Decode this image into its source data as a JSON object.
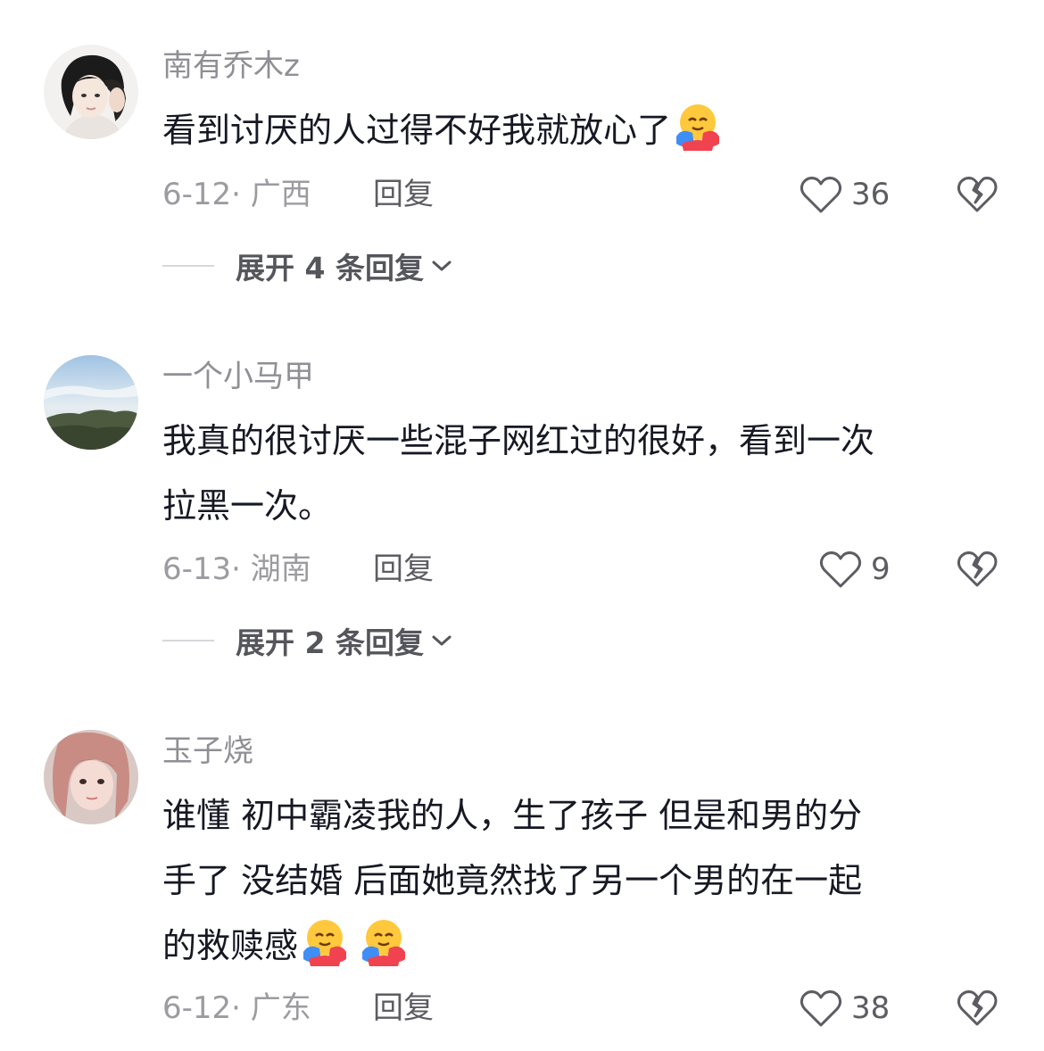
{
  "comments": [
    {
      "username": "南有乔木z",
      "content_lines": [
        "看到讨厌的人过得不好我就放心了"
      ],
      "emoji": [
        "hugging-face-icon"
      ],
      "date": "6-12",
      "location": "广西",
      "date_location": "6-12· 广西",
      "reply_label": "回复",
      "likes": "36",
      "expand_label": "展开 4 条回复"
    },
    {
      "username": "一个小马甲",
      "content_lines": [
        "我真的很讨厌一些混子网红过的很好，看到一次",
        "拉黑一次。"
      ],
      "emoji": [],
      "date": "6-13",
      "location": "湖南",
      "date_location": "6-13· 湖南",
      "reply_label": "回复",
      "likes": "9",
      "expand_label": "展开 2 条回复"
    },
    {
      "username": "玉子烧",
      "content_lines": [
        "谁懂 初中霸凌我的人，生了孩子 但是和男的分",
        "手了 没结婚  后面她竟然找了另一个男的在一起",
        "的救赎感"
      ],
      "emoji": [
        "hugging-face-icon",
        "hugging-face-icon"
      ],
      "date": "6-12",
      "location": "广东",
      "date_location": "6-12· 广东",
      "reply_label": "回复",
      "likes": "38"
    }
  ],
  "colors": {
    "username": "#8f8f95",
    "content": "#161823",
    "meta": "#9b9ba0",
    "action": "#5c5c63"
  }
}
